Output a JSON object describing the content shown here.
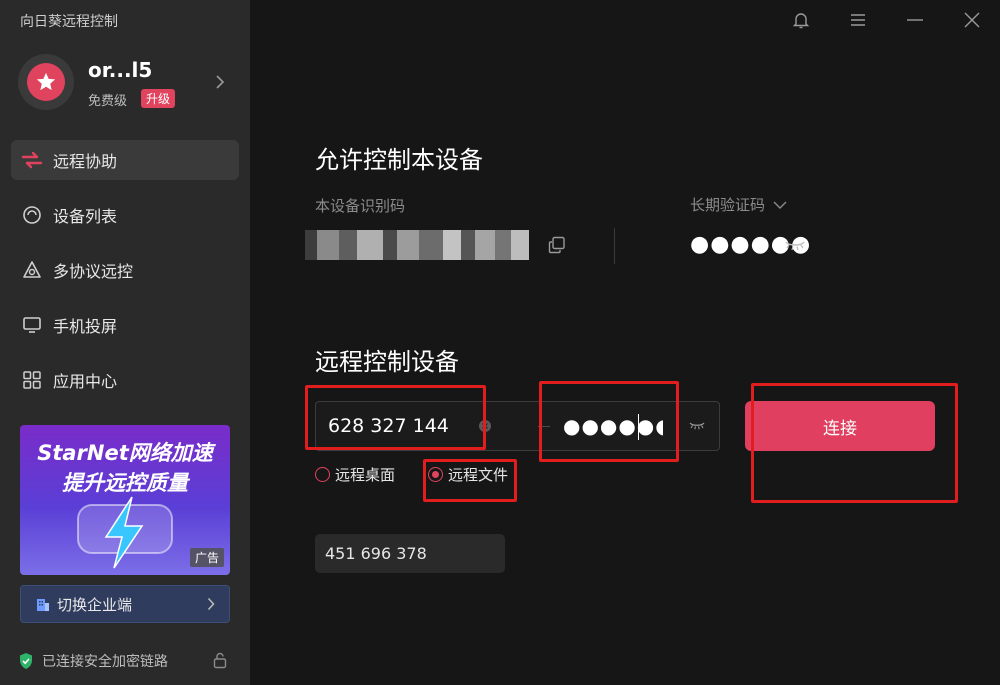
{
  "app": {
    "title": "向日葵远程控制"
  },
  "profile": {
    "name": "or...l5",
    "tier": "免费级",
    "upgrade": "升级"
  },
  "nav": [
    {
      "label": "远程协助",
      "icon": "remote-assist-icon",
      "active": true
    },
    {
      "label": "设备列表",
      "icon": "device-list-icon",
      "active": false
    },
    {
      "label": "多协议远控",
      "icon": "multi-protocol-icon",
      "active": false
    },
    {
      "label": "手机投屏",
      "icon": "screen-cast-icon",
      "active": false
    },
    {
      "label": "应用中心",
      "icon": "app-center-icon",
      "active": false
    }
  ],
  "ad": {
    "line1": "StarNet网络加速",
    "line2": "提升远控质量",
    "tag": "广告"
  },
  "enterprise": {
    "label": "切换企业端"
  },
  "status": {
    "secure": "已连接安全加密链路"
  },
  "allow_section": {
    "title": "允许控制本设备",
    "device_id_label": "本设备识别码",
    "code_type_label": "长期验证码",
    "code_masked": "●●●●●●"
  },
  "remote_section": {
    "title": "远程控制设备",
    "partner_id": "628 327 144",
    "password_masked": "●●●●●●",
    "connect_label": "连接",
    "mode_desktop": "远程桌面",
    "mode_file": "远程文件",
    "selected_mode": "远程文件",
    "recent": "451 696 378"
  },
  "colors": {
    "accent": "#e0435e",
    "sidebar_bg": "#2a2a2a",
    "main_bg": "#161616",
    "annotation": "#e11d1d"
  }
}
